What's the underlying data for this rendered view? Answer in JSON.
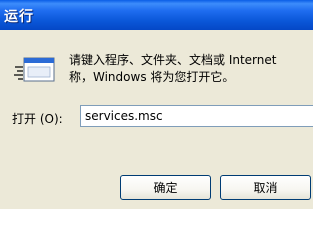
{
  "window": {
    "title": "运行"
  },
  "dialog": {
    "description_line1": "请键入程序、文件夹、文档或 Internet",
    "description_line2": "称，Windows 将为您打开它。",
    "open_label": "打开 (O):",
    "open_value": "services.msc",
    "ok_label": "确定",
    "cancel_label": "取消"
  },
  "icons": {
    "run": "run-dialog-icon"
  }
}
